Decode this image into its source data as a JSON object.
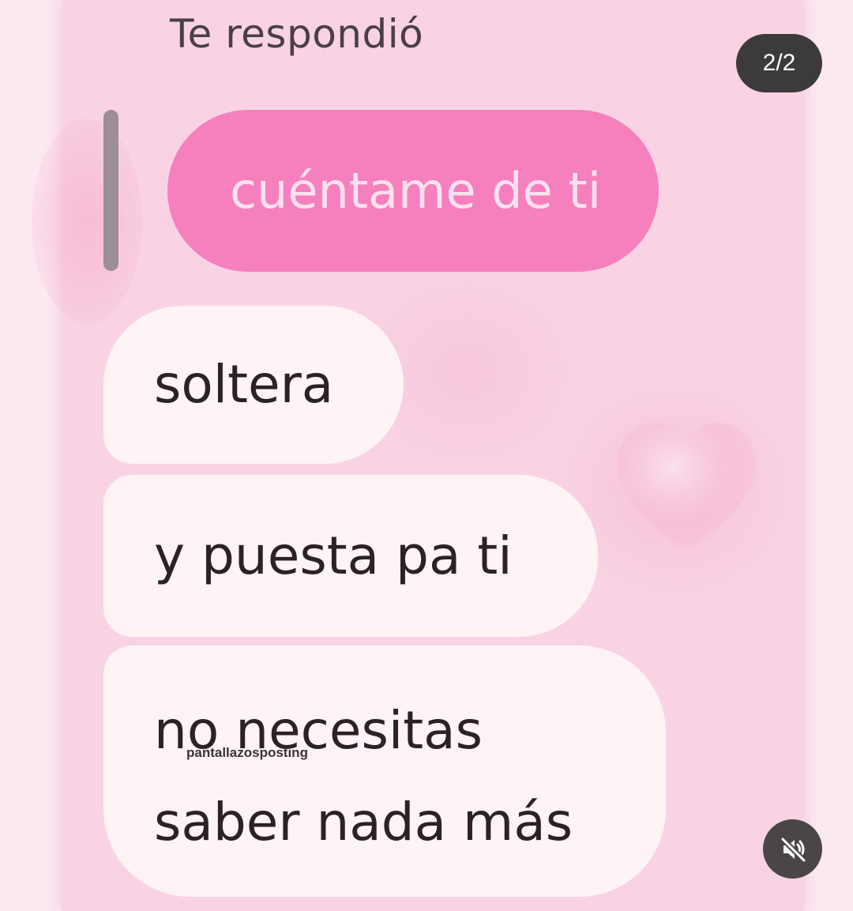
{
  "header": {
    "title": "Te respondió"
  },
  "story": {
    "counter": "2/2"
  },
  "reply": {
    "quoted_text": "cuéntame de ti"
  },
  "messages": [
    {
      "text": "soltera"
    },
    {
      "text": "y puesta pa ti"
    },
    {
      "lines": [
        "no necesitas",
        "saber nada más"
      ]
    }
  ],
  "watermark": "pantallazosposting",
  "controls": {
    "mute_icon": "speaker-muted-icon"
  },
  "colors": {
    "background": "#f9d3e4",
    "quoted_bubble": "#f580bd",
    "message_bubble": "#fef3f5"
  }
}
